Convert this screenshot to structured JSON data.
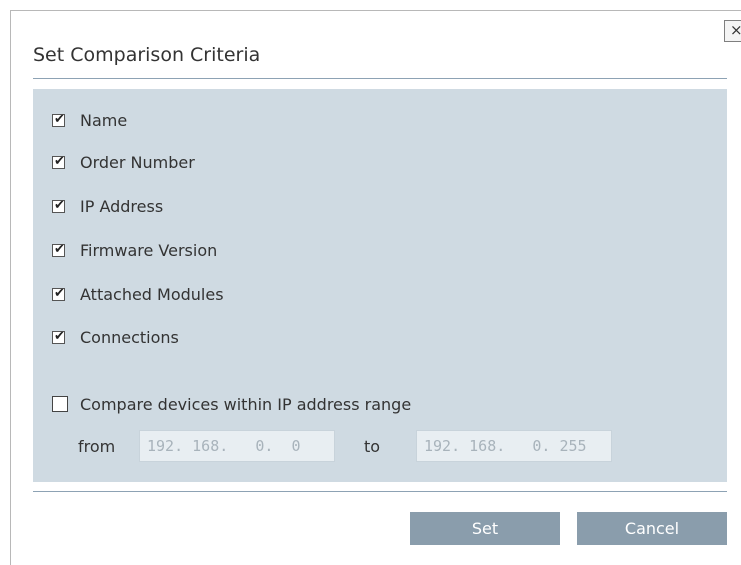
{
  "dialog": {
    "title": "Set Comparison Criteria",
    "close_label": "×"
  },
  "criteria": [
    {
      "label": "Name",
      "checked": true
    },
    {
      "label": "Order Number",
      "checked": true
    },
    {
      "label": "IP Address",
      "checked": true
    },
    {
      "label": "Firmware Version",
      "checked": true
    },
    {
      "label": "Attached Modules",
      "checked": true
    },
    {
      "label": "Connections",
      "checked": true
    }
  ],
  "ip_range": {
    "label": "Compare devices within IP address range",
    "checked": false,
    "from_label": "from",
    "from_value": "192. 168.   0.  0",
    "to_label": "to",
    "to_value": "192. 168.   0. 255"
  },
  "buttons": {
    "set_label": "Set",
    "cancel_label": "Cancel"
  },
  "colors": {
    "panel": "#cfdae2",
    "button": "#8a9dac",
    "rule": "#8da2b4"
  }
}
